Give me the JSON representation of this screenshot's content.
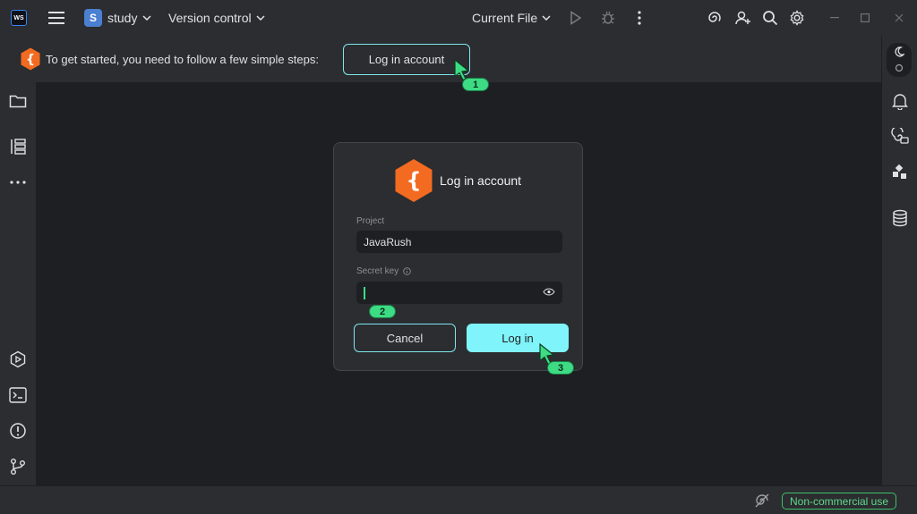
{
  "titlebar": {
    "app_logo_text": "WS",
    "project_badge": "S",
    "project_name": "study",
    "vcs_label": "Version control",
    "run_config": "Current File"
  },
  "notification": {
    "message": "To get started, you need to follow a few simple steps:",
    "button_label": "Log in account"
  },
  "dialog": {
    "title": "Log in account",
    "project_label": "Project",
    "project_value": "JavaRush",
    "secret_key_label": "Secret key",
    "secret_key_value": "",
    "cancel_label": "Cancel",
    "login_label": "Log in"
  },
  "steps": [
    "1",
    "2",
    "3"
  ],
  "statusbar": {
    "license_badge": "Non-commercial use"
  },
  "icons": {
    "left": [
      "folder-icon",
      "structure-icon",
      "more-icon",
      "services-icon",
      "terminal-icon",
      "problems-icon",
      "git-icon"
    ],
    "right": [
      "theme-toggle-icon",
      "notifications-icon",
      "ai-assistant-icon",
      "plugin-icon",
      "database-icon"
    ]
  },
  "colors": {
    "accent": "#7ff5fb",
    "brand_orange": "#f26b21",
    "step_green": "#3ddc84",
    "license_green": "#5fd98a"
  }
}
